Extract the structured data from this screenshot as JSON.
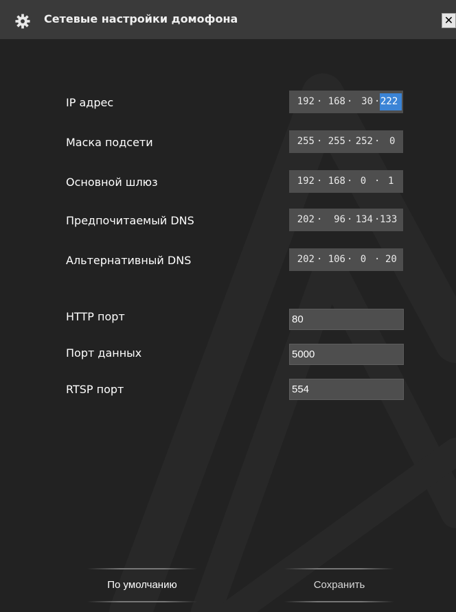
{
  "window": {
    "title": "Сетевые настройки домофона",
    "close_glyph": "✕"
  },
  "fields": [
    {
      "label": "IP адрес",
      "octets": [
        "192",
        "168",
        "30",
        "222"
      ],
      "selected_octet": 4
    },
    {
      "label": "Маска подсети",
      "octets": [
        "255",
        "255",
        "252",
        "0"
      ]
    },
    {
      "label": "Основной шлюз",
      "octets": [
        "192",
        "168",
        "0",
        "1"
      ]
    },
    {
      "label": "Предпочитаемый DNS",
      "octets": [
        "202",
        "96",
        "134",
        "133"
      ]
    },
    {
      "label": "Альтернативный DNS",
      "octets": [
        "202",
        "106",
        "0",
        "20"
      ]
    }
  ],
  "ports": [
    {
      "label": "HTTP порт",
      "value": "80"
    },
    {
      "label": "Порт данных",
      "value": "5000"
    },
    {
      "label": "RTSP порт",
      "value": "554"
    }
  ],
  "buttons": {
    "default": "По умолчанию",
    "save": "Сохранить"
  },
  "colors": {
    "background": "#222222",
    "titlebar": "#3a3a3a",
    "field": "#4e4e4e",
    "selection": "#3b84d6"
  },
  "icons": {
    "title": "gear-icon",
    "close": "close-icon"
  }
}
